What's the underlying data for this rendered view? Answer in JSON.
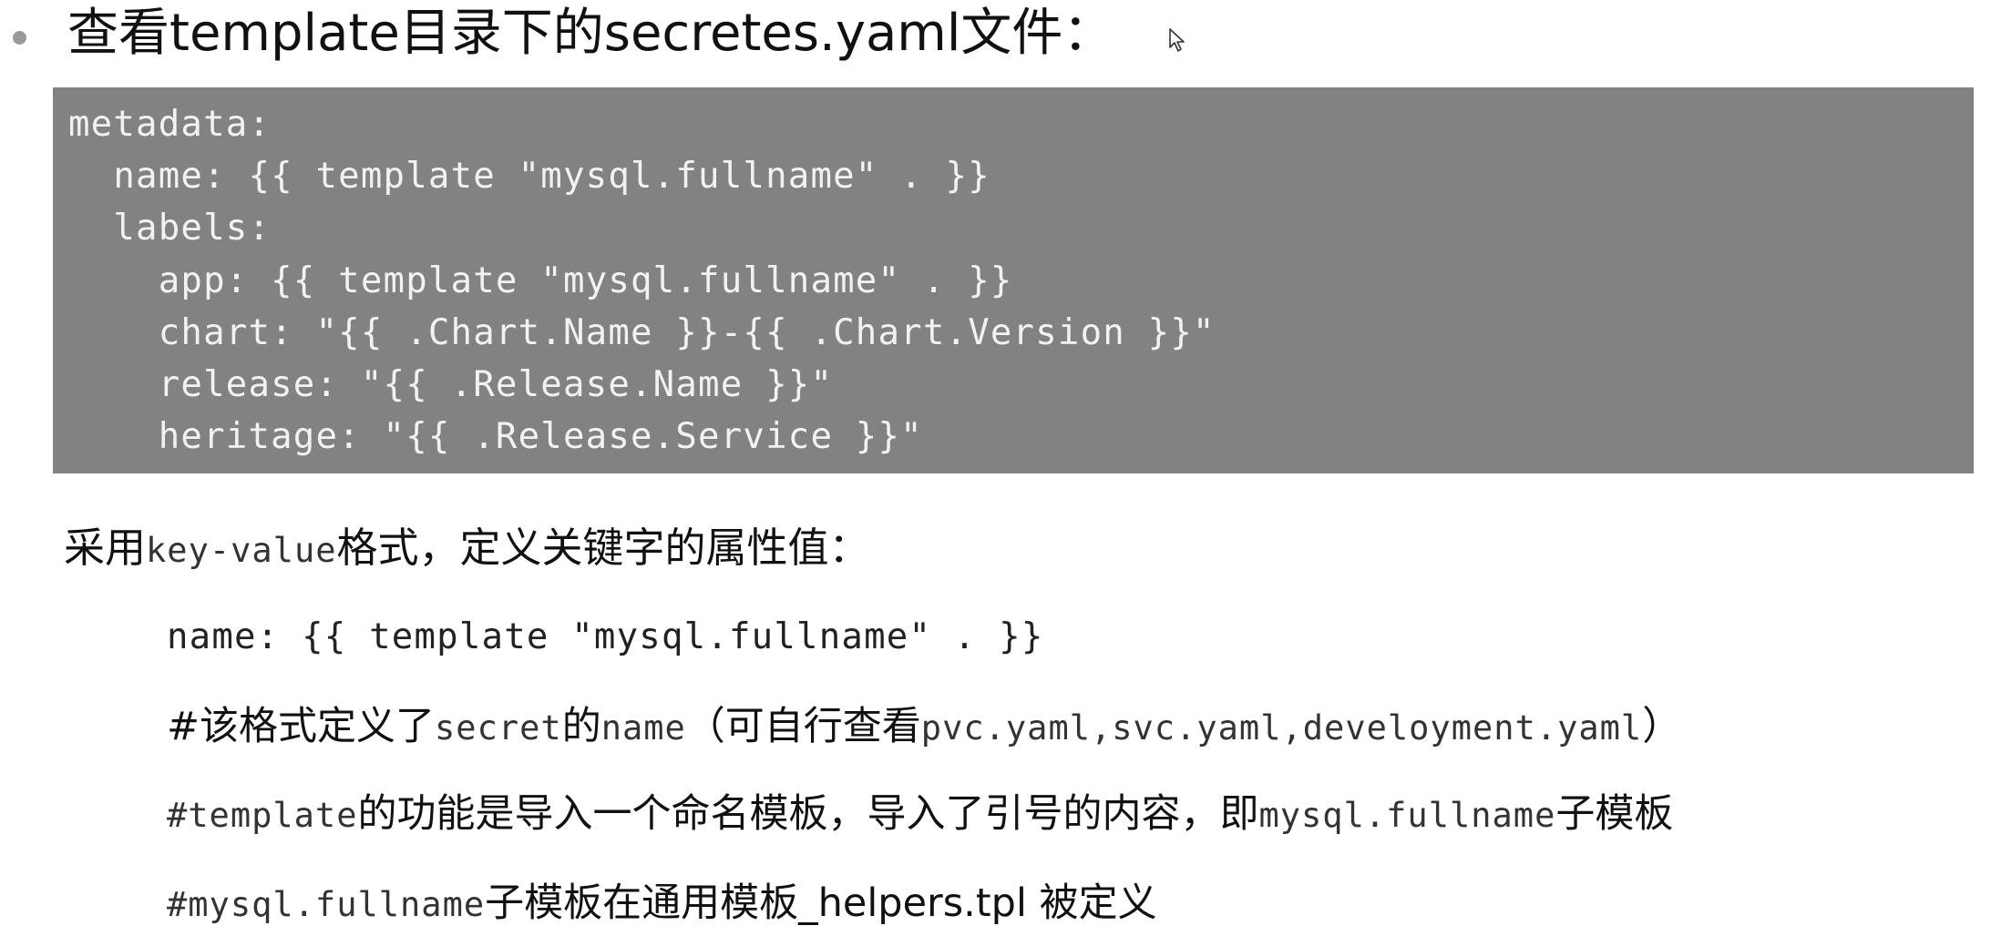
{
  "heading": {
    "text": "查看template目录下的secretes.yaml文件："
  },
  "code_block": {
    "lines": [
      "metadata:",
      "  name: {{ template \"mysql.fullname\" . }}",
      "  labels:",
      "    app: {{ template \"mysql.fullname\" . }}",
      "    chart: \"{{ .Chart.Name }}-{{ .Chart.Version }}\"",
      "    release: \"{{ .Release.Name }}\"",
      "    heritage: \"{{ .Release.Service }}\""
    ]
  },
  "intro": {
    "part1": "采用",
    "part2": "key-value",
    "part3": "格式，定义关键字的属性值："
  },
  "example": {
    "text": "name: {{ template \"mysql.fullname\" . }}"
  },
  "notes": {
    "note1": {
      "part1": "#该格式定义了",
      "part2": "secret",
      "part3": "的",
      "part4": "name",
      "part5": "（可自行查看",
      "part6": "pvc.yaml,svc.yaml,develoyment.yaml",
      "part7": "）"
    },
    "note2": {
      "part1": "#template",
      "part2": "的功能是导入一个命名模板，导入了引号的内容，即",
      "part3": "mysql.fullname",
      "part4": "子模板"
    },
    "note3": {
      "part1": "#mysql.fullname",
      "part2": "子模板在通用模板_helpers.tpl 被定义"
    }
  },
  "icons": {
    "bullet": "bullet-dot",
    "cursor": "mouse-pointer-icon"
  },
  "colors": {
    "code_background": "#828282",
    "code_text": "#f2f2f2",
    "bullet": "#9a9a9a"
  }
}
